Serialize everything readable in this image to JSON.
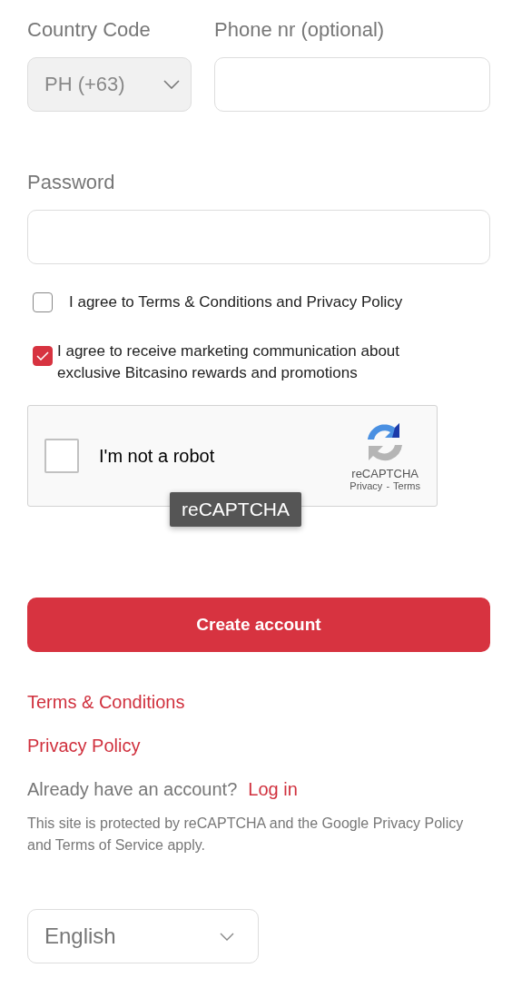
{
  "country_code": {
    "label": "Country Code",
    "value": "PH (+63)"
  },
  "phone": {
    "label": "Phone nr (optional)"
  },
  "password": {
    "label": "Password"
  },
  "agreements": [
    {
      "text": "I agree to Terms & Conditions and Privacy Policy",
      "checked": false
    },
    {
      "text": "I agree to receive marketing communication about exclusive Bitcasino rewards and promotions",
      "checked": true
    }
  ],
  "captcha": {
    "label": "I'm not a robot",
    "checked": false,
    "brand": "reCAPTCHA",
    "privacy_link": "Privacy",
    "separator": "-",
    "terms_link": "Terms",
    "tooltip": "reCAPTCHA"
  },
  "submit_button": "Create account",
  "links": [
    "Terms & Conditions",
    "Privacy Policy"
  ],
  "login_prompt": {
    "text": "Already have an account?",
    "link": "Log in"
  },
  "notice": "This site is protected by reCAPTCHA and the Google Privacy Policy and Terms of Service apply.",
  "language": {
    "value": "English"
  }
}
